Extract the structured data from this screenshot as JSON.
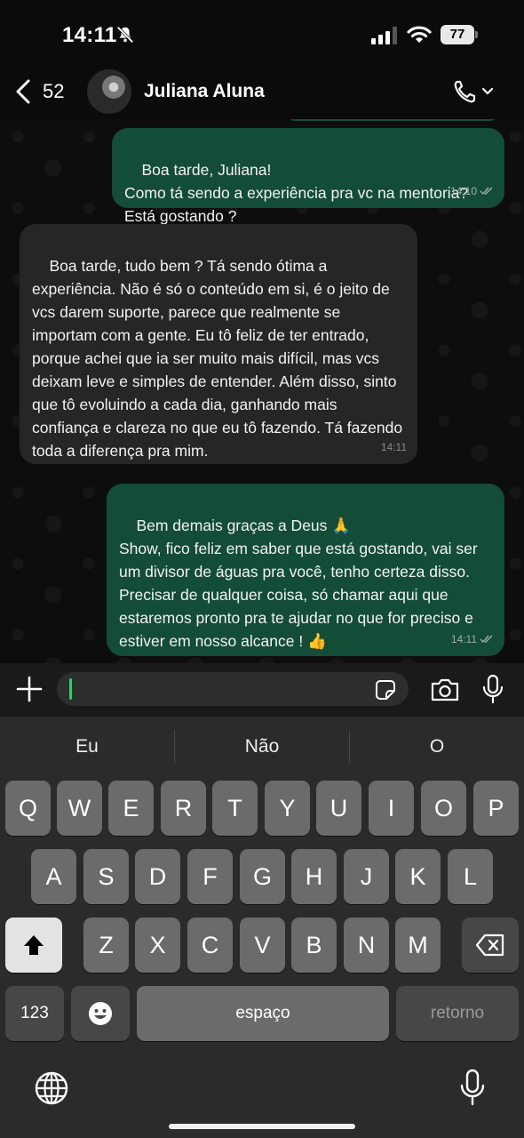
{
  "status_bar": {
    "time": "14:11",
    "battery": "77"
  },
  "header": {
    "back_count": "52",
    "contact_name": "Juliana Aluna"
  },
  "messages": [
    {
      "direction": "outgoing",
      "text": "Boa tarde, Juliana!\nComo tá sendo a experiência pra vc na mentoria? Está gostando ?",
      "time": "14:10"
    },
    {
      "direction": "incoming",
      "text": "Boa tarde, tudo bem ? Tá sendo ótima a experiência. Não é só o conteúdo em si, é o jeito de vcs darem suporte, parece que realmente se importam com a gente. Eu tô feliz de ter entrado, porque achei que ia ser muito mais difícil, mas vcs deixam leve e simples de entender. Além disso, sinto que tô evoluindo a cada dia, ganhando mais confiança e clareza no que eu tô fazendo. Tá fazendo toda a diferença pra mim.",
      "time": "14:11"
    },
    {
      "direction": "outgoing",
      "text": "Bem demais graças a Deus 🙏\nShow, fico feliz em saber que está gostando, vai ser um divisor de águas pra você, tenho certeza disso.\nPrecisar de qualquer coisa, só chamar aqui que estaremos pronto pra te ajudar no que for preciso e estiver em nosso alcance ! 👍",
      "time": "14:11"
    }
  ],
  "keyboard": {
    "suggestions": [
      "Eu",
      "Não",
      "O"
    ],
    "row1": [
      "Q",
      "W",
      "E",
      "R",
      "T",
      "Y",
      "U",
      "I",
      "O",
      "P"
    ],
    "row2": [
      "A",
      "S",
      "D",
      "F",
      "G",
      "H",
      "J",
      "K",
      "L"
    ],
    "row3": [
      "Z",
      "X",
      "C",
      "V",
      "B",
      "N",
      "M"
    ],
    "numbers_key": "123",
    "space_key": "espaço",
    "return_key": "retorno"
  },
  "colors": {
    "outgoing_bubble": "#144d37",
    "incoming_bubble": "#262626",
    "cursor": "#25d366"
  }
}
